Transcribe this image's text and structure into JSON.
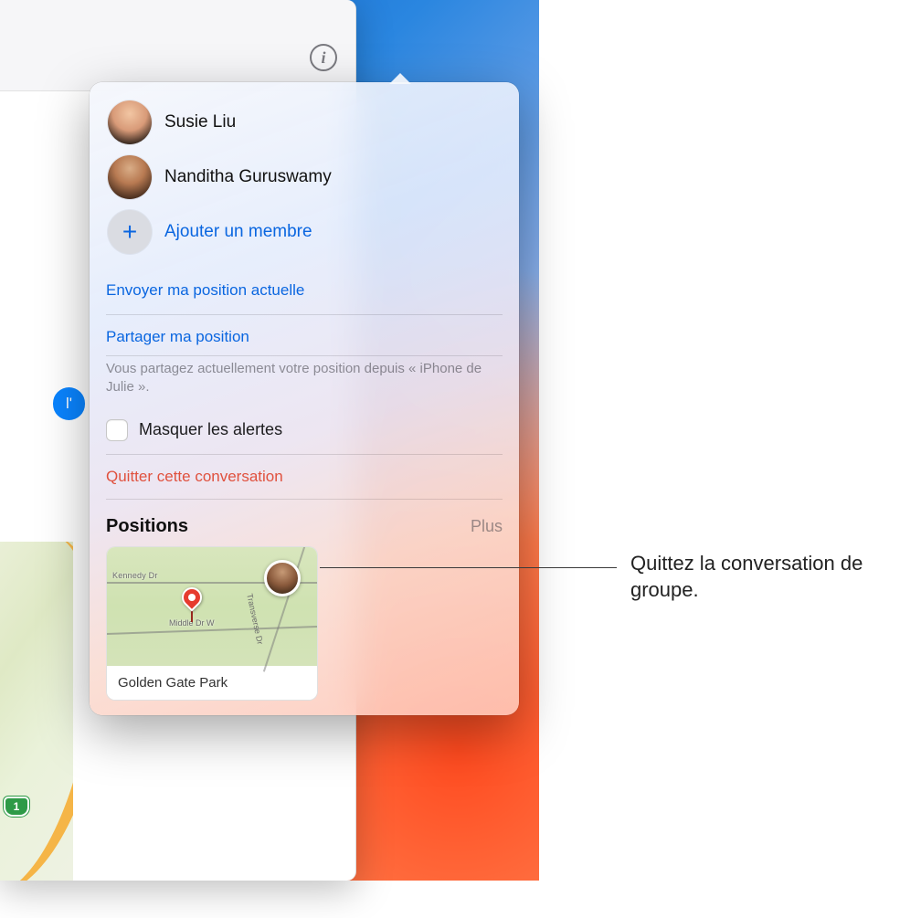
{
  "toolbar": {
    "info_glyph": "i"
  },
  "msg_bubble_text": "l'",
  "route_shield": "1",
  "members": [
    {
      "name": "Susie Liu"
    },
    {
      "name": "Nanditha Guruswamy"
    }
  ],
  "add_member_label": "Ajouter un membre",
  "send_location_label": "Envoyer ma position actuelle",
  "share_location_label": "Partager ma position",
  "share_note": "Vous partagez actuellement votre position depuis « iPhone de Julie ».",
  "hide_alerts_label": "Masquer les alertes",
  "leave_conversation_label": "Quitter cette conversation",
  "positions_section": {
    "title": "Positions",
    "more": "Plus"
  },
  "mini_map": {
    "road1": "Kennedy Dr",
    "road2": "Middle Dr W",
    "road3": "Transverse Dr"
  },
  "location_card_caption": "Golden Gate Park",
  "callout": "Quittez la conversation de groupe.",
  "add_plus": "+"
}
